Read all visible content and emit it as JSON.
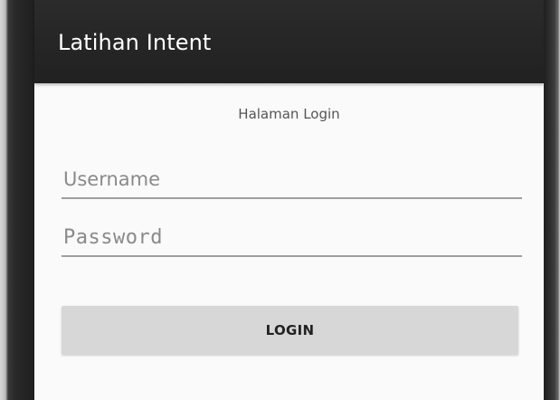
{
  "app_bar": {
    "title": "Latihan Intent"
  },
  "main": {
    "heading": "Halaman Login",
    "username_field": {
      "placeholder": "Username",
      "value": ""
    },
    "password_field": {
      "placeholder": "Password",
      "value": ""
    },
    "login_button": {
      "label": "LOGIN"
    }
  },
  "colors": {
    "app_bar_background": "#212121",
    "screen_background": "#fafafa",
    "button_background": "#d7d7d7",
    "field_underline": "#9e9e9e"
  }
}
